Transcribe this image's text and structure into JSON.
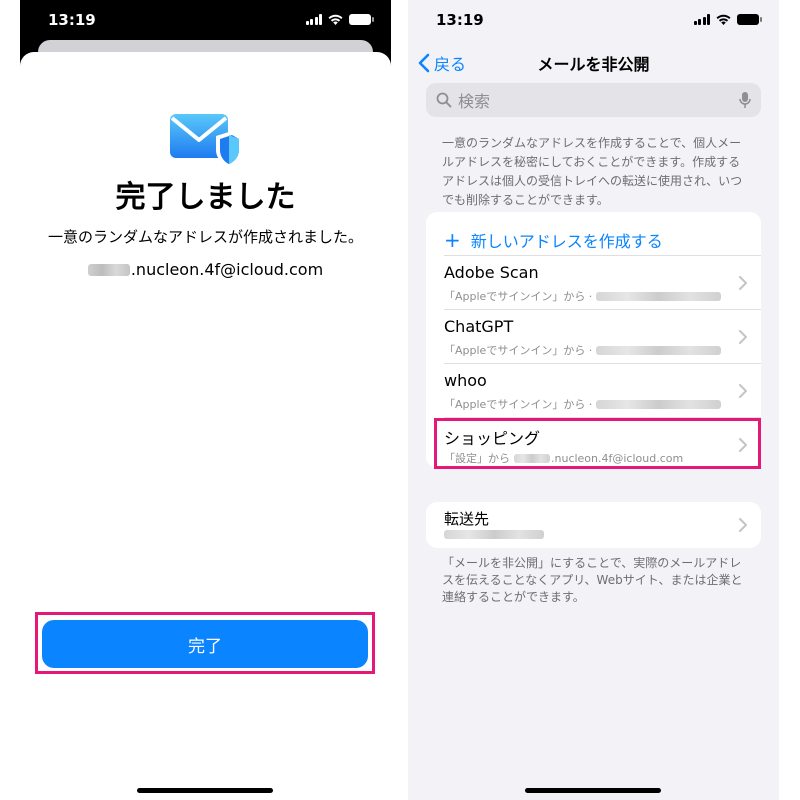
{
  "left_screen": {
    "status_time": "13:19",
    "title": "完了しました",
    "description": "一意のランダムなアドレスが作成されました。",
    "email_suffix": ".nucleon.4f@icloud.com",
    "done_button": "完了"
  },
  "right_screen": {
    "status_time": "13:19",
    "back_label": "戻る",
    "title": "メールを非公開",
    "search_placeholder": "検索",
    "info_text": "一意のランダムなアドレスを作成することで、個人メールアドレスを秘密にしておくことができます。作成するアドレスは個人の受信トレイへの転送に使用され、いつでも削除することができます。",
    "add_address": "新しいアドレスを作成する",
    "items": [
      {
        "title": "Adobe Scan",
        "subtitle": "「Appleでサインイン」から ·"
      },
      {
        "title": "ChatGPT",
        "subtitle": "「Appleでサインイン」から ·"
      },
      {
        "title": "whoo",
        "subtitle": "「Appleでサインイン」から ·"
      },
      {
        "title": "ショッピング",
        "subtitle": "「設定」から",
        "subtitle_email": ".nucleon.4f@icloud.com"
      }
    ],
    "forward_label": "転送先",
    "footer_text": "「メールを非公開」にすることで、実際のメールアドレスを伝えることなくアプリ、Webサイト、または企業と連絡することができます。"
  },
  "colors": {
    "accent": "#0a84ff",
    "highlight": "#e5187a",
    "grouped_bg": "#f2f2f7"
  }
}
